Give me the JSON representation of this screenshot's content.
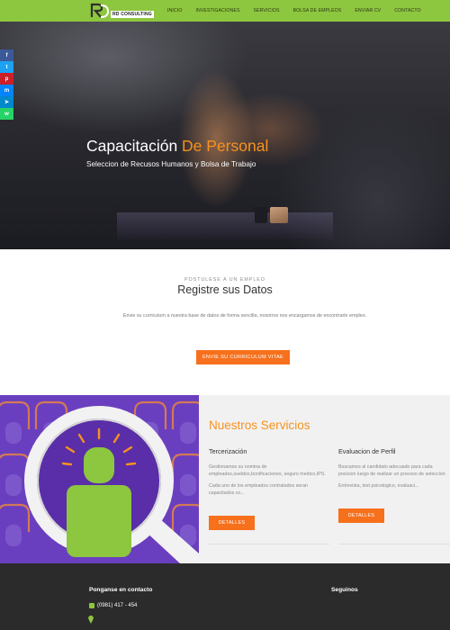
{
  "brand": {
    "name": "RD CONSULTING",
    "accent": "#8dc63f",
    "orange": "#f7701c"
  },
  "nav": {
    "items": [
      "INICIO",
      "INVESTIGACIONES",
      "SERVICIOS",
      "BOLSA DE EMPLEOS",
      "ENVIAR CV",
      "CONTACTO"
    ]
  },
  "hero": {
    "title_part1": "Capacitación",
    "title_part2": "De Personal",
    "subtitle": "Seleccion de Recusos Humanos y Bolsa de Trabajo"
  },
  "social": [
    {
      "icon": "facebook-icon",
      "glyph": "f",
      "color": "#3b5998"
    },
    {
      "icon": "twitter-icon",
      "glyph": "t",
      "color": "#1da1f2"
    },
    {
      "icon": "pinterest-icon",
      "glyph": "p",
      "color": "#cb2027"
    },
    {
      "icon": "messenger-icon",
      "glyph": "m",
      "color": "#0084ff"
    },
    {
      "icon": "telegram-icon",
      "glyph": "➤",
      "color": "#0088cc"
    },
    {
      "icon": "whatsapp-icon",
      "glyph": "w",
      "color": "#25d366"
    }
  ],
  "register": {
    "kicker": "POSTULESE A UN EMPLEO",
    "title": "Registre sus Datos",
    "text": "Envie su curriculum a nuestra base de datos de forma sencilla, nosotros nos encargamos de encontrarle empleo.",
    "button": "ENVIE SU CURRICULUM VITAE"
  },
  "services": {
    "title": "Nuestros Servicios",
    "items": [
      {
        "title": "Tercerización",
        "text1": "Gestionamos su nomina de empleados,sueldos,bonificaciones, seguro medico,IPS.",
        "text2": "Cada uno de los empleados contratados seran capacitados co...",
        "button": "DETALLES"
      },
      {
        "title": "Evaluacion de Perfil",
        "text1": "Buscamos al candidato adecuado para cada posicion luego de realizar un proceso de seleccion",
        "text2": "Entrevista, test psicologico, evaluaci...",
        "button": "DETALLES"
      }
    ]
  },
  "footer": {
    "contact_heading": "Ponganse en contacto",
    "phone": "(0981) 417 - 454",
    "follow_heading": "Seguinos"
  }
}
